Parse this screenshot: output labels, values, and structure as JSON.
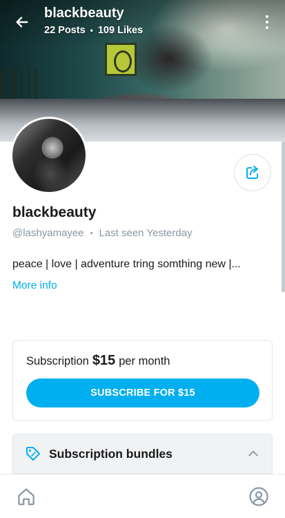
{
  "header": {
    "title": "blackbeauty",
    "posts": "22 Posts",
    "separator": "•",
    "likes": "109 Likes",
    "back_icon": "arrow-left-icon",
    "more_icon": "more-vertical-icon"
  },
  "profile": {
    "display_name": "blackbeauty",
    "handle": "@lashyamayee",
    "separator": "•",
    "last_seen": "Last seen Yesterday",
    "bio": "peace | love | adventure tring somthing new |...",
    "more_info": "More info",
    "share_icon": "share-icon"
  },
  "subscription": {
    "label": "Subscription",
    "price": "$15",
    "period": "per month",
    "button_label": "SUBSCRIBE FOR $15"
  },
  "bundles": {
    "label": "Subscription bundles",
    "icon": "tag-icon",
    "toggle_icon": "chevron-up-icon"
  },
  "bottom_nav": {
    "home_icon": "home-icon",
    "profile_icon": "profile-icon"
  },
  "colors": {
    "accent": "#00aff0",
    "muted_text": "#8a96a3",
    "border": "#e2e5e8",
    "bundles_bg": "#f0f2f4"
  }
}
